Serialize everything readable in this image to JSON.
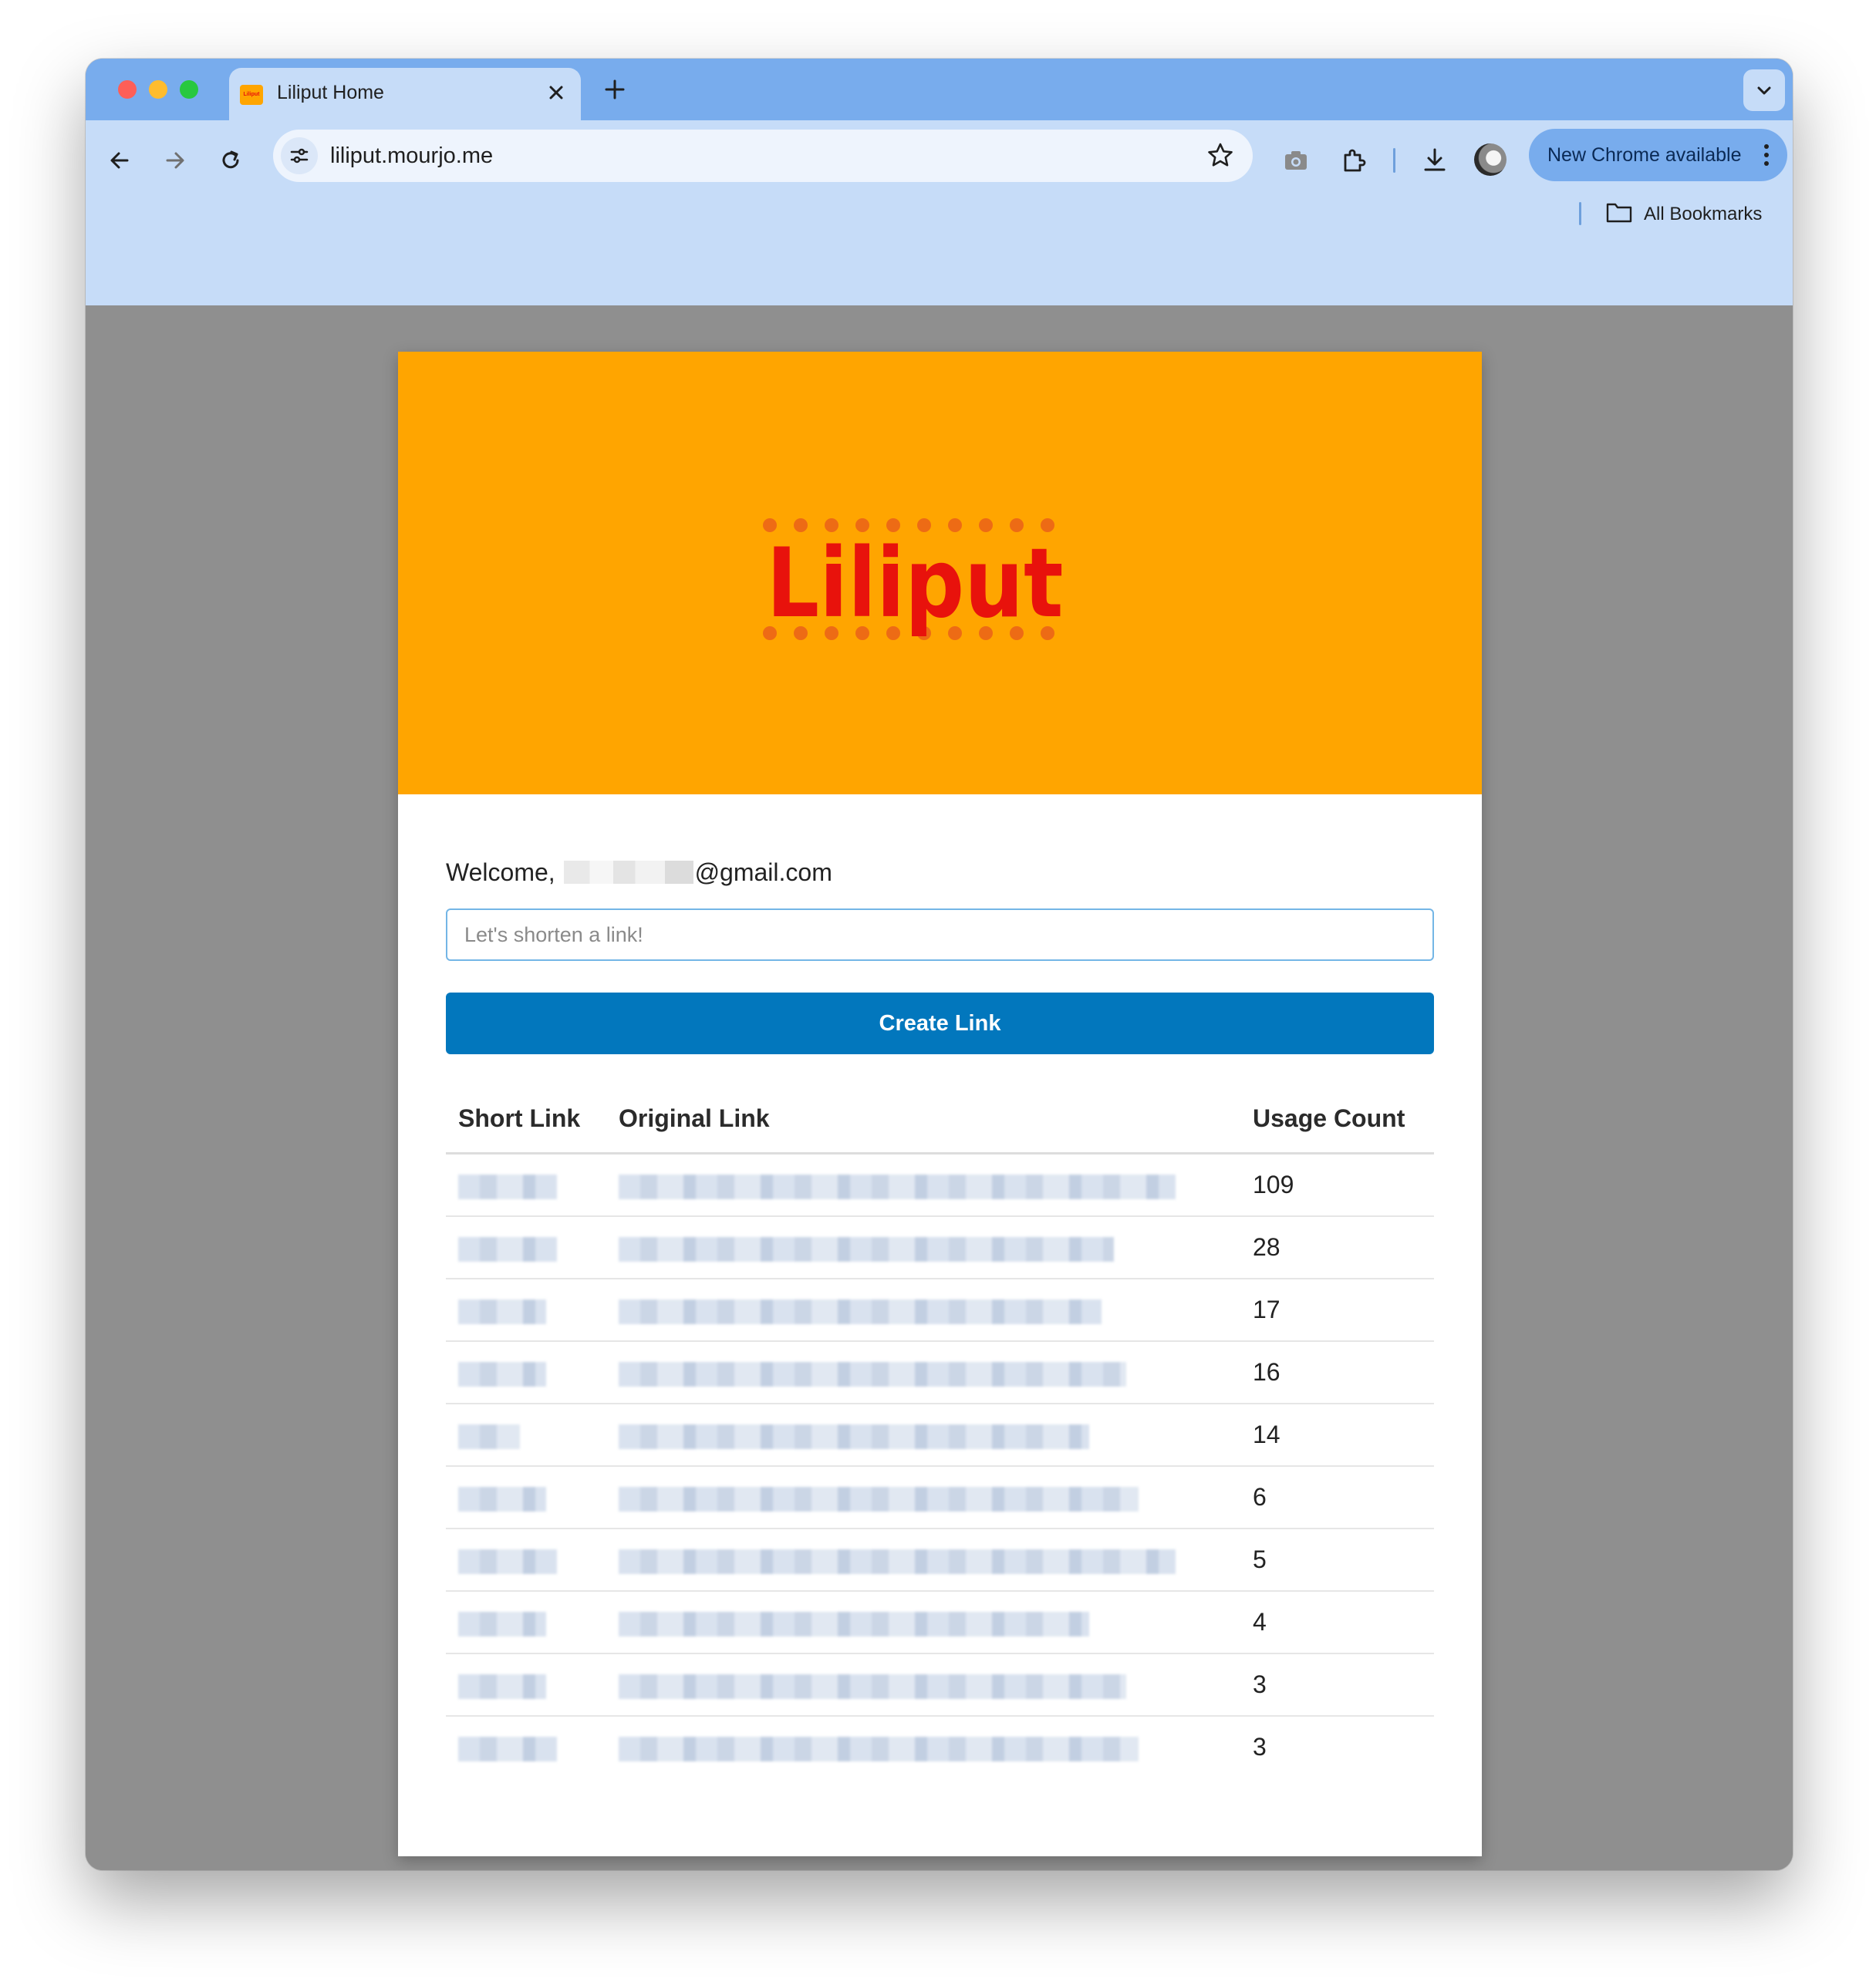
{
  "browser": {
    "tab_title": "Liliput Home",
    "tab_favicon_text": "Liliput",
    "url": "liliput.mourjo.me",
    "update_label": "New Chrome available",
    "bookmarks_label": "All Bookmarks"
  },
  "app": {
    "logo_text": "Liliput",
    "welcome_prefix": "Welcome,",
    "welcome_email_suffix": "@gmail.com",
    "input_placeholder": "Let's shorten a link!",
    "create_button_label": "Create Link",
    "columns": [
      "Short Link",
      "Original Link",
      "Usage Count"
    ],
    "rows": [
      {
        "usage_count": "109"
      },
      {
        "usage_count": "28"
      },
      {
        "usage_count": "17"
      },
      {
        "usage_count": "16"
      },
      {
        "usage_count": "14"
      },
      {
        "usage_count": "6"
      },
      {
        "usage_count": "5"
      },
      {
        "usage_count": "4"
      },
      {
        "usage_count": "3"
      },
      {
        "usage_count": "3"
      }
    ]
  },
  "colors": {
    "hero_background": "#ffa500",
    "logo_red": "#e8120c",
    "button_blue": "#0277bd",
    "tabstrip_blue": "#78aced",
    "toolbar_blue": "#c6dcf8"
  },
  "icons": {
    "window_controls": [
      "close-dot",
      "minimize-dot",
      "zoom-dot"
    ],
    "navigation": [
      "back-arrow-icon",
      "forward-arrow-icon",
      "reload-icon"
    ],
    "toolbar": [
      "camera-icon",
      "extensions-icon",
      "download-icon",
      "profile-avatar",
      "kebab-menu-icon"
    ]
  }
}
